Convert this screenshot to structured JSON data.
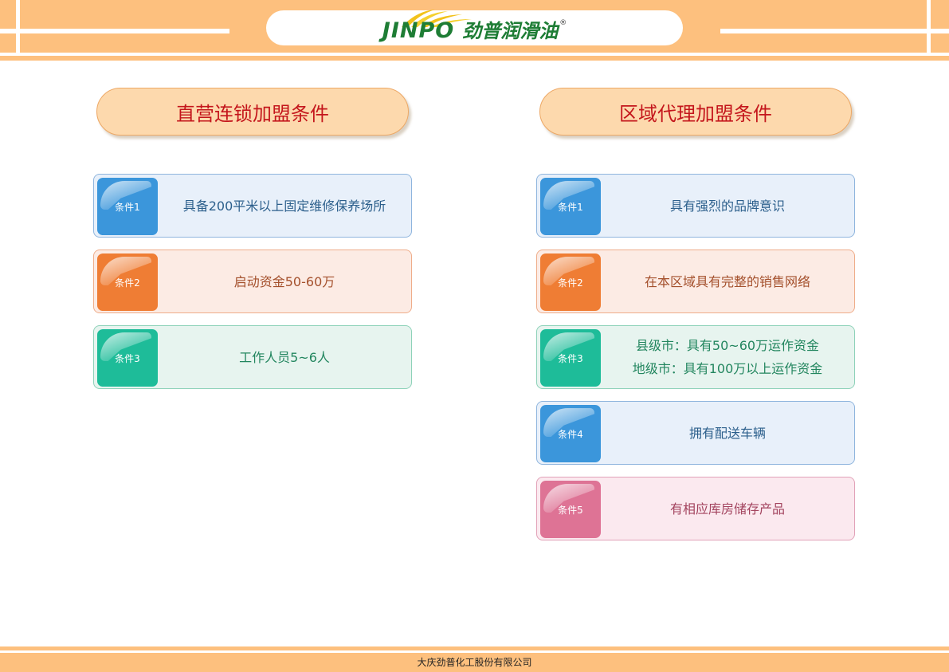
{
  "header": {
    "logo_latin": "JINPO",
    "logo_cn": "劲普润滑油",
    "logo_reg": "®"
  },
  "colors": {
    "header_band": "#fdc07e",
    "title_red": "#c4161c",
    "logo_green": "#1e7d35",
    "badge_blue": "#3b96db",
    "badge_orange": "#ef7d34",
    "badge_green": "#1ebc99",
    "badge_pink": "#de7395"
  },
  "left_section": {
    "title": "直营连锁加盟条件",
    "conditions": [
      {
        "badge": "条件1",
        "lines": [
          "具备200平米以上固定维修保养场所"
        ],
        "color": "blue"
      },
      {
        "badge": "条件2",
        "lines": [
          "启动资金50-60万"
        ],
        "color": "orange"
      },
      {
        "badge": "条件3",
        "lines": [
          "工作人员5~6人"
        ],
        "color": "green"
      }
    ]
  },
  "right_section": {
    "title": "区域代理加盟条件",
    "conditions": [
      {
        "badge": "条件1",
        "lines": [
          "具有强烈的品牌意识"
        ],
        "color": "blue"
      },
      {
        "badge": "条件2",
        "lines": [
          "在本区域具有完整的销售网络"
        ],
        "color": "orange"
      },
      {
        "badge": "条件3",
        "lines": [
          "县级市：具有50~60万运作资金",
          "地级市：具有100万以上运作资金"
        ],
        "color": "green"
      },
      {
        "badge": "条件4",
        "lines": [
          "拥有配送车辆"
        ],
        "color": "blue"
      },
      {
        "badge": "条件5",
        "lines": [
          "有相应库房储存产品"
        ],
        "color": "pink"
      }
    ]
  },
  "footer": {
    "company": "大庆劲普化工股份有限公司"
  }
}
